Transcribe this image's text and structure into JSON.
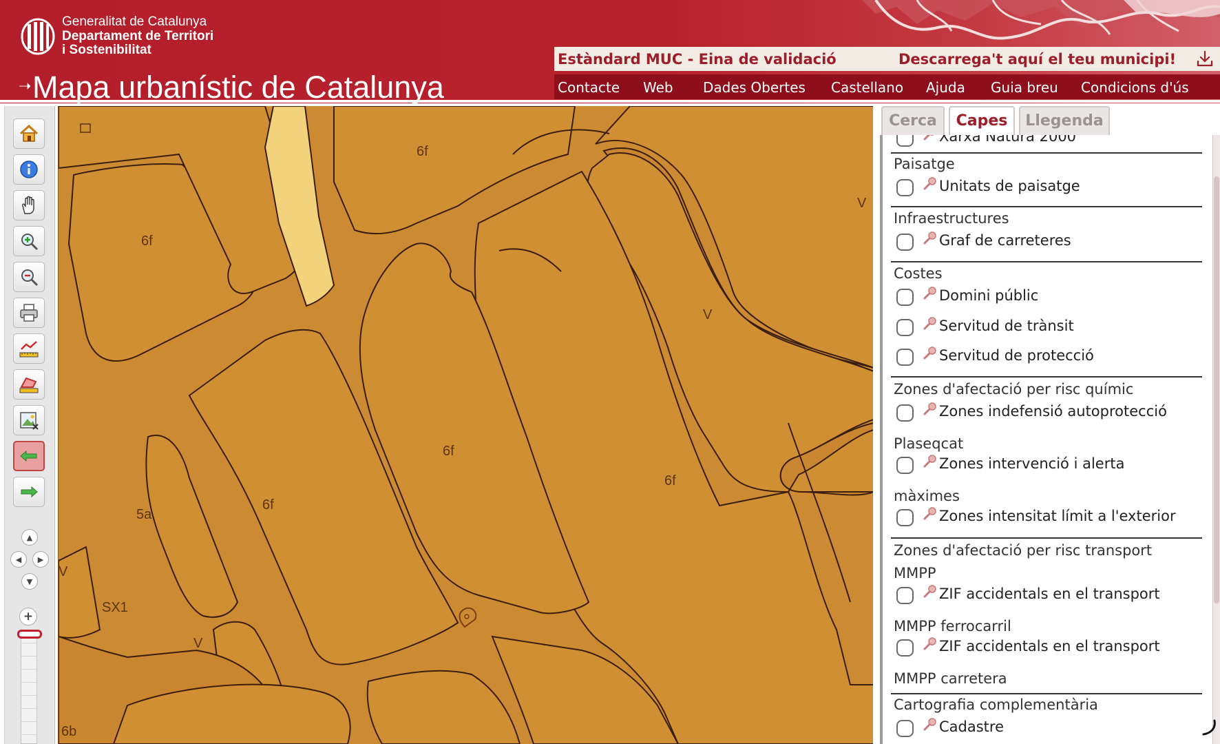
{
  "header": {
    "org_lines": [
      "Generalitat de Catalunya",
      "Departament de Territori",
      "i Sostenibilitat"
    ],
    "app_title": "Mapa urbanístic de Catalunya",
    "muc_tool": "Estàndard MUC - Eina de validació",
    "download_link": "Descarrega't aquí el teu municipi!",
    "nav": [
      "Contacte",
      "Web",
      "Dades Obertes",
      "Castellano",
      "Ajuda",
      "Guia breu",
      "Condicions d'ús"
    ],
    "colors": {
      "brand_red": "#b21e2a",
      "nav_bg": "#8e0e1c",
      "title_bar_bg": "#f3ece4"
    }
  },
  "toolbar": {
    "tools": [
      {
        "name": "home-icon"
      },
      {
        "name": "info-icon"
      },
      {
        "name": "pan-hand-icon"
      },
      {
        "name": "zoom-in-icon"
      },
      {
        "name": "zoom-out-icon"
      },
      {
        "name": "print-icon"
      },
      {
        "name": "measure-distance-icon"
      },
      {
        "name": "measure-area-icon"
      },
      {
        "name": "image-export-icon"
      },
      {
        "name": "back-arrow-icon"
      },
      {
        "name": "forward-arrow-icon"
      }
    ],
    "active_tool": "back-arrow-icon"
  },
  "map": {
    "labels": [
      "6f",
      "6f",
      "V",
      "V",
      "6f",
      "6f",
      "6f",
      "5a",
      "SX1",
      "V",
      "6b",
      "V"
    ],
    "colors": {
      "zone_fill": "#d18f34",
      "road_fill": "#c8862e",
      "lines": "#3a1d0c",
      "highlight": "#f2d27a"
    }
  },
  "panel": {
    "tabs": [
      "Cerca",
      "Capes",
      "Llegenda"
    ],
    "active_tab": "Capes",
    "top_partial_layer": "Xarxa Natura 2000",
    "groups": [
      {
        "title": "Paisatge",
        "layers": [
          "Unitats de paisatge"
        ]
      },
      {
        "title": "Infraestructures",
        "layers": [
          "Graf de carreteres"
        ]
      },
      {
        "title": "Costes",
        "layers": [
          "Domini públic",
          "Servitud de trànsit",
          "Servitud de protecció"
        ]
      },
      {
        "title": "Zones d'afectació per risc químic",
        "layers": [
          "Zones indefensió autoprotecció"
        ]
      },
      {
        "title": "Plaseqcat",
        "layers": [
          "Zones intervenció i alerta"
        ]
      },
      {
        "title": "màximes",
        "layers": [
          "Zones intensitat límit a l'exterior"
        ]
      },
      {
        "title_lines": [
          "Zones d'afectació per risc transport",
          "MMPP"
        ],
        "layers": [
          "ZIF accidentals en el transport"
        ]
      },
      {
        "title": "MMPP ferrocarril",
        "layers": [
          "ZIF accidentals en el transport"
        ]
      },
      {
        "title": "MMPP carretera",
        "layers": []
      },
      {
        "title": "Cartografia complementària",
        "layers": [
          "Cadastre"
        ]
      }
    ]
  }
}
